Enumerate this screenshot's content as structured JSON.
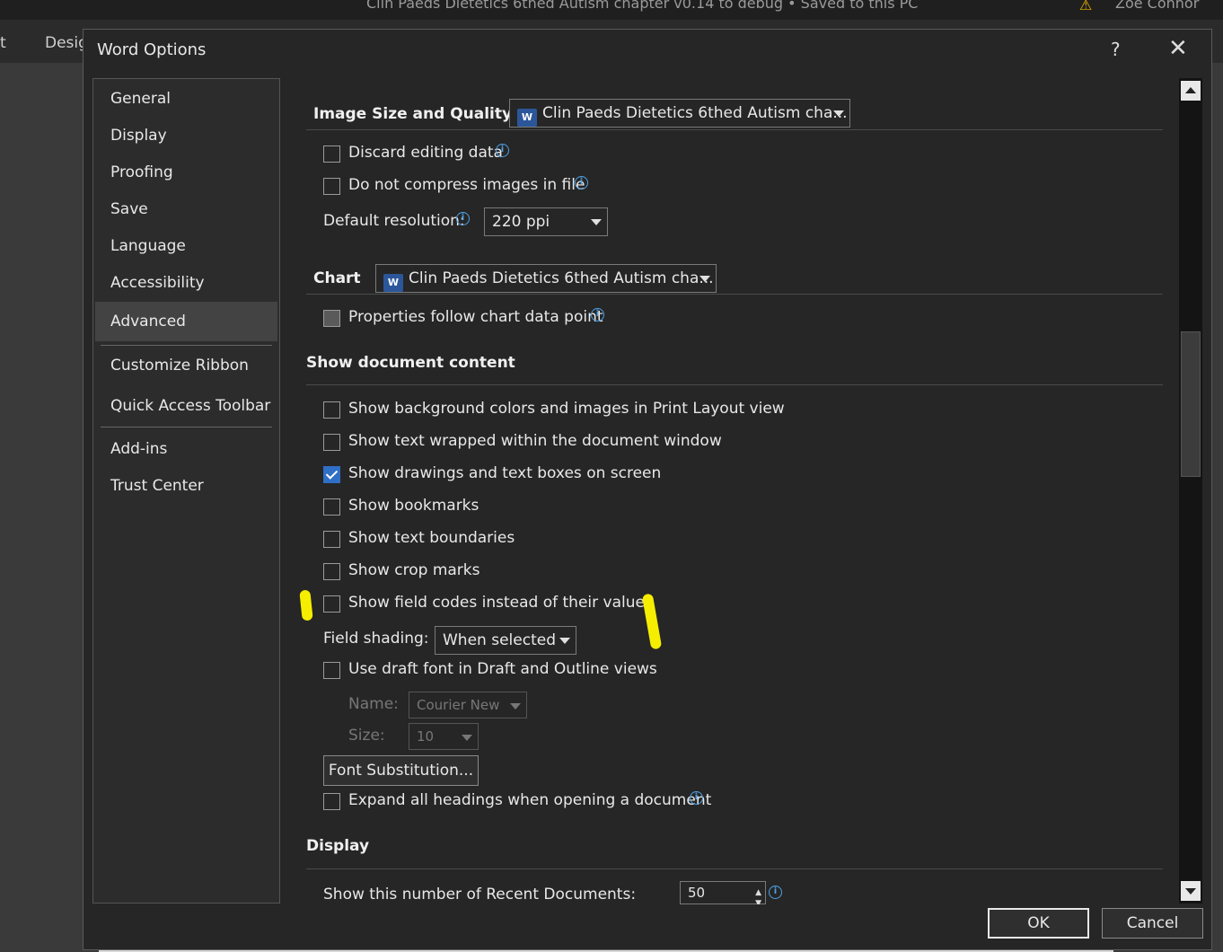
{
  "background": {
    "title": "Clin Paeds Dietetics 6thed Autism chapter v0.14 to debug • Saved to this PC",
    "user": "Zoe Connor",
    "tabs": [
      "t",
      "Desig"
    ]
  },
  "dialog": {
    "title": "Word Options",
    "help": "?",
    "close": "✕"
  },
  "nav": {
    "items": [
      "General",
      "Display",
      "Proofing",
      "Save",
      "Language",
      "Accessibility",
      "Advanced",
      "Customize Ribbon",
      "Quick Access Toolbar",
      "Add-ins",
      "Trust Center"
    ],
    "selected": "Advanced"
  },
  "image_size": {
    "heading": "Image Size and Quality",
    "document": "Clin Paeds Dietetics 6thed Autism cha...",
    "discard_editing": "Discard editing data",
    "do_not_compress": "Do not compress images in file",
    "default_resolution_label": "Default resolution:",
    "default_resolution": "220 ppi"
  },
  "chart": {
    "heading": "Chart",
    "document": "Clin Paeds Dietetics 6thed Autism cha...",
    "properties_follow": "Properties follow chart data point"
  },
  "show_content": {
    "heading": "Show document content",
    "options": [
      {
        "label": "Show background colors and images in Print Layout view",
        "checked": false
      },
      {
        "label": "Show text wrapped within the document window",
        "checked": false
      },
      {
        "label": "Show drawings and text boxes on screen",
        "checked": true
      },
      {
        "label": "Show bookmarks",
        "checked": false
      },
      {
        "label": "Show text boundaries",
        "checked": false
      },
      {
        "label": "Show crop marks",
        "checked": false
      },
      {
        "label": "Show field codes instead of their values",
        "checked": false
      }
    ],
    "field_shading_label": "Field shading:",
    "field_shading": "When selected",
    "draft_font": "Use draft font in Draft and Outline views",
    "name_label": "Name:",
    "name_value": "Courier New",
    "size_label": "Size:",
    "size_value": "10",
    "font_substitution": "Font Substitution...",
    "expand_headings": "Expand all headings when opening a document"
  },
  "display": {
    "heading": "Display",
    "recent_docs_label": "Show this number of Recent Documents:",
    "recent_docs_value": "50"
  },
  "footer": {
    "ok": "OK",
    "cancel": "Cancel"
  },
  "colors": {
    "accent": "#2f6fc6",
    "highlight": "#f5ee00",
    "info": "#4ea1e6"
  }
}
